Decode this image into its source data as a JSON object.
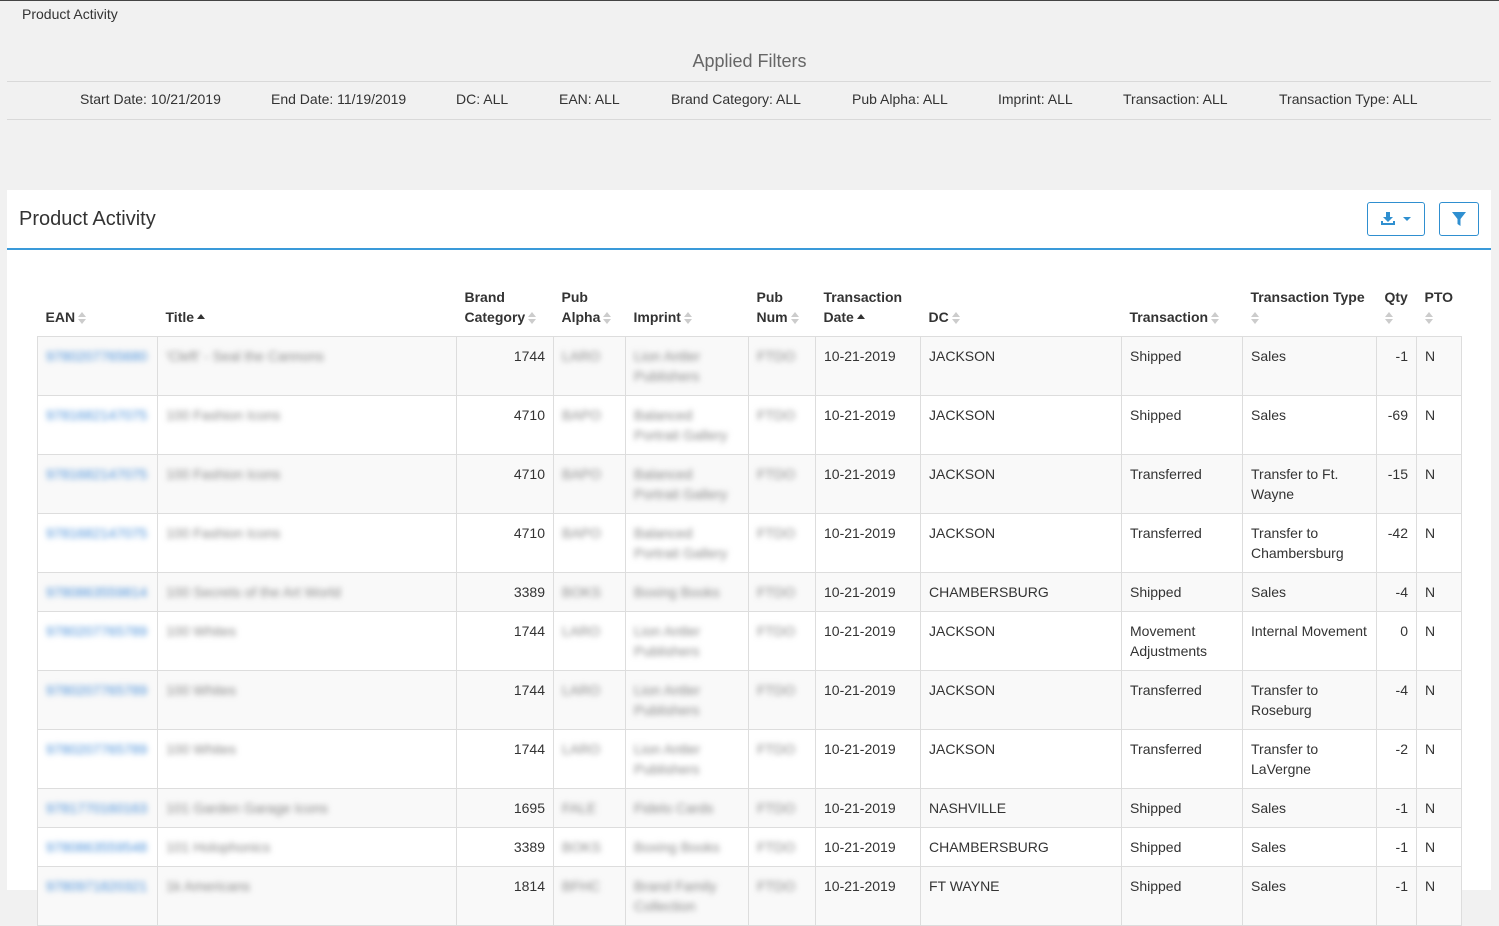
{
  "breadcrumb": "Product Activity",
  "filters": {
    "title": "Applied Filters",
    "items": [
      "Start Date: 10/21/2019",
      "End Date: 11/19/2019",
      "DC: ALL",
      "EAN: ALL",
      "Brand Category: ALL",
      "Pub Alpha: ALL",
      "Imprint: ALL",
      "Transaction: ALL",
      "Transaction Type: ALL"
    ]
  },
  "panel": {
    "title": "Product Activity",
    "download_icon": "download-icon",
    "filter_icon": "filter-icon"
  },
  "table": {
    "columns": [
      {
        "label": "EAN",
        "sort": "none"
      },
      {
        "label": "Title",
        "sort": "asc"
      },
      {
        "label": "Brand Category",
        "sort": "none"
      },
      {
        "label": "Pub Alpha",
        "sort": "none"
      },
      {
        "label": "Imprint",
        "sort": "none"
      },
      {
        "label": "Pub Num",
        "sort": "none"
      },
      {
        "label": "Transaction Date",
        "sort": "asc"
      },
      {
        "label": "DC",
        "sort": "none"
      },
      {
        "label": "Transaction",
        "sort": "none"
      },
      {
        "label": "Transaction Type",
        "sort": "none"
      },
      {
        "label": "Qty",
        "sort": "none"
      },
      {
        "label": "PTO",
        "sort": "none"
      }
    ],
    "rows": [
      {
        "ean": "9780207765680",
        "title": "'Cleft' - Seal the Cannons",
        "brand_category": "1744",
        "pub_alpha": "LARO",
        "imprint": "Lion Antler Publishers",
        "pub_num": "FTDO",
        "date": "10-21-2019",
        "dc": "JACKSON",
        "transaction": "Shipped",
        "type": "Sales",
        "qty": "-1",
        "pto": "N"
      },
      {
        "ean": "9781682147075",
        "title": "100 Fashion Icons",
        "brand_category": "4710",
        "pub_alpha": "BAPO",
        "imprint": "Balanced Portrait Gallery",
        "pub_num": "FTDO",
        "date": "10-21-2019",
        "dc": "JACKSON",
        "transaction": "Shipped",
        "type": "Sales",
        "qty": "-69",
        "pto": "N"
      },
      {
        "ean": "9781682147075",
        "title": "100 Fashion Icons",
        "brand_category": "4710",
        "pub_alpha": "BAPO",
        "imprint": "Balanced Portrait Gallery",
        "pub_num": "FTDO",
        "date": "10-21-2019",
        "dc": "JACKSON",
        "transaction": "Transferred",
        "type": "Transfer to Ft. Wayne",
        "qty": "-15",
        "pto": "N"
      },
      {
        "ean": "9781682147075",
        "title": "100 Fashion Icons",
        "brand_category": "4710",
        "pub_alpha": "BAPO",
        "imprint": "Balanced Portrait Gallery",
        "pub_num": "FTDO",
        "date": "10-21-2019",
        "dc": "JACKSON",
        "transaction": "Transferred",
        "type": "Transfer to Chambersburg",
        "qty": "-42",
        "pto": "N"
      },
      {
        "ean": "9780863559814",
        "title": "100 Secrets of the Art World",
        "brand_category": "3389",
        "pub_alpha": "BOKS",
        "imprint": "Boxing Books",
        "pub_num": "FTDO",
        "date": "10-21-2019",
        "dc": "CHAMBERSBURG",
        "transaction": "Shipped",
        "type": "Sales",
        "qty": "-4",
        "pto": "N"
      },
      {
        "ean": "9780207765789",
        "title": "100 Whites",
        "brand_category": "1744",
        "pub_alpha": "LARO",
        "imprint": "Lion Antler Publishers",
        "pub_num": "FTDO",
        "date": "10-21-2019",
        "dc": "JACKSON",
        "transaction": "Movement Adjustments",
        "type": "Internal Movement",
        "qty": "0",
        "pto": "N"
      },
      {
        "ean": "9780207765789",
        "title": "100 Whites",
        "brand_category": "1744",
        "pub_alpha": "LARO",
        "imprint": "Lion Antler Publishers",
        "pub_num": "FTDO",
        "date": "10-21-2019",
        "dc": "JACKSON",
        "transaction": "Transferred",
        "type": "Transfer to Roseburg",
        "qty": "-4",
        "pto": "N"
      },
      {
        "ean": "9780207765789",
        "title": "100 Whites",
        "brand_category": "1744",
        "pub_alpha": "LARO",
        "imprint": "Lion Antler Publishers",
        "pub_num": "FTDO",
        "date": "10-21-2019",
        "dc": "JACKSON",
        "transaction": "Transferred",
        "type": "Transfer to LaVergne",
        "qty": "-2",
        "pto": "N"
      },
      {
        "ean": "9781770160163",
        "title": "101 Garden Garage Icons",
        "brand_category": "1695",
        "pub_alpha": "FALE",
        "imprint": "Fidelo Cards",
        "pub_num": "FTDO",
        "date": "10-21-2019",
        "dc": "NASHVILLE",
        "transaction": "Shipped",
        "type": "Sales",
        "qty": "-1",
        "pto": "N"
      },
      {
        "ean": "9780863559548",
        "title": "101 Holophonics",
        "brand_category": "3389",
        "pub_alpha": "BOKS",
        "imprint": "Boxing Books",
        "pub_num": "FTDO",
        "date": "10-21-2019",
        "dc": "CHAMBERSBURG",
        "transaction": "Shipped",
        "type": "Sales",
        "qty": "-1",
        "pto": "N"
      },
      {
        "ean": "9780971820321",
        "title": "1k Americans",
        "brand_category": "1814",
        "pub_alpha": "BFHC",
        "imprint": "Brand Family Collection",
        "pub_num": "FTDO",
        "date": "10-21-2019",
        "dc": "FT WAYNE",
        "transaction": "Shipped",
        "type": "Sales",
        "qty": "-1",
        "pto": "N"
      }
    ]
  }
}
